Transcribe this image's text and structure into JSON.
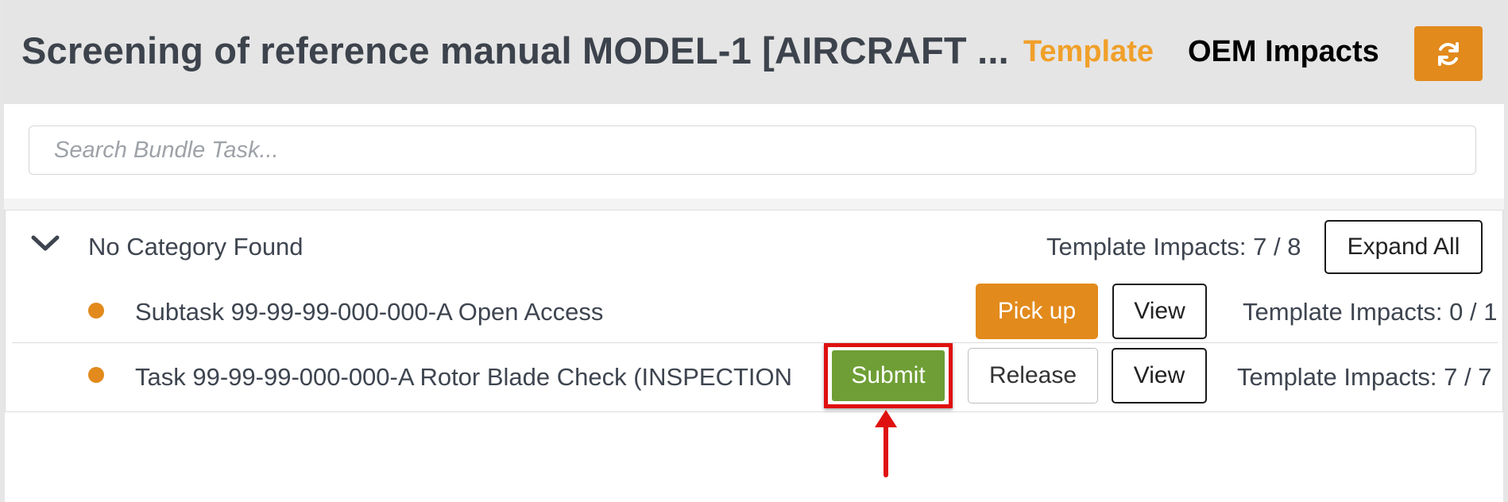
{
  "header": {
    "title": "Screening of reference manual MODEL-1 [AIRCRAFT ...",
    "tabs": [
      {
        "label": "Template",
        "active": true
      },
      {
        "label": "OEM Impacts",
        "active": false
      }
    ],
    "refresh_icon": "refresh-icon"
  },
  "search": {
    "placeholder": "Search Bundle Task...",
    "value": ""
  },
  "category": {
    "label": "No Category Found",
    "impacts": "Template Impacts: 7 / 8",
    "expand_label": "Expand All",
    "toggle_icon": "chevron-down-icon"
  },
  "tasks": [
    {
      "label": "Subtask 99-99-99-000-000-A Open Access",
      "pickup_label": "Pick up",
      "view_label": "View",
      "impacts": "Template Impacts: 0 / 1"
    },
    {
      "label": "Task 99-99-99-000-000-A Rotor Blade Check (INSPECTION",
      "submit_label": "Submit",
      "release_label": "Release",
      "view_label": "View",
      "impacts": "Template Impacts: 7 / 7"
    }
  ],
  "colors": {
    "accent": "#e28a1c",
    "active_tab": "#f0a02a",
    "submit": "#6e9e35",
    "highlight": "#e01010"
  }
}
